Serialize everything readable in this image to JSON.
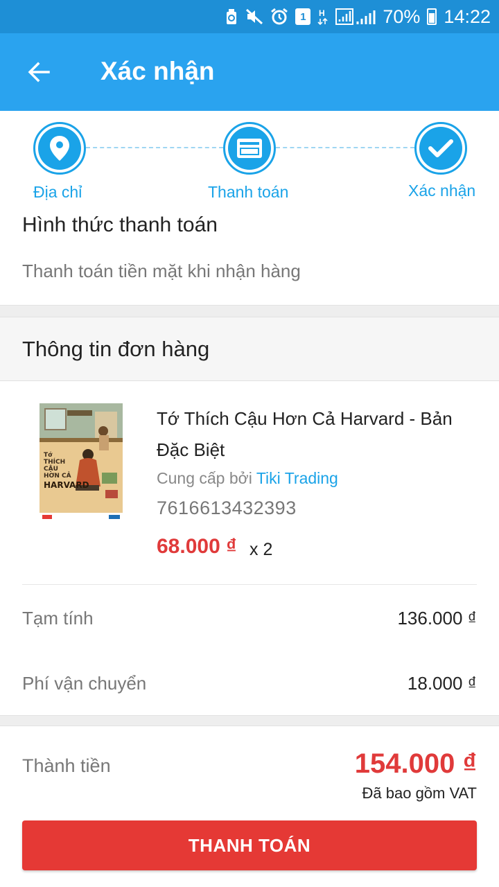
{
  "status_bar": {
    "notification_count": "1",
    "battery": "70%",
    "time": "14:22",
    "icons": [
      "recycle-icon",
      "mute-icon",
      "alarm-icon",
      "data-icon",
      "signal-icon",
      "battery-icon"
    ]
  },
  "app_bar": {
    "title": "Xác nhận",
    "back_icon": "arrow-left-icon"
  },
  "stepper": {
    "steps": [
      {
        "label": "Địa chỉ",
        "icon": "location-pin-icon"
      },
      {
        "label": "Thanh toán",
        "icon": "credit-card-icon"
      },
      {
        "label": "Xác nhận",
        "icon": "check-icon"
      }
    ]
  },
  "payment": {
    "title": "Hình thức thanh toán",
    "method": "Thanh toán tiền mặt khi nhận hàng"
  },
  "order": {
    "header": "Thông tin đơn hàng",
    "product": {
      "name": "Tớ Thích Cậu Hơn Cả Harvard - Bản Đặc Biệt",
      "seller_prefix": "Cung cấp bởi",
      "seller_name": "Tiki Trading",
      "sku": "7616613432393",
      "price": "68.000 ₫",
      "quantity": "x 2",
      "cover_lines": [
        "Tớ",
        "THÍCH",
        "CẬU",
        "HƠN CẢ",
        "HARVARD"
      ]
    },
    "subtotal_label": "Tạm tính",
    "subtotal_value": "136.000 ₫",
    "shipping_label": "Phí vận chuyển",
    "shipping_value": "18.000 ₫"
  },
  "total": {
    "label": "Thành tiền",
    "value": "154.000 ₫",
    "vat_note": "Đã bao gồm VAT"
  },
  "checkout_button": "THANH TOÁN",
  "colors": {
    "app_bar": "#2aa3ef",
    "status_bar": "#1e8fd6",
    "accent": "#1aa3e8",
    "price_red": "#e03a3a",
    "button_red": "#e53935"
  }
}
